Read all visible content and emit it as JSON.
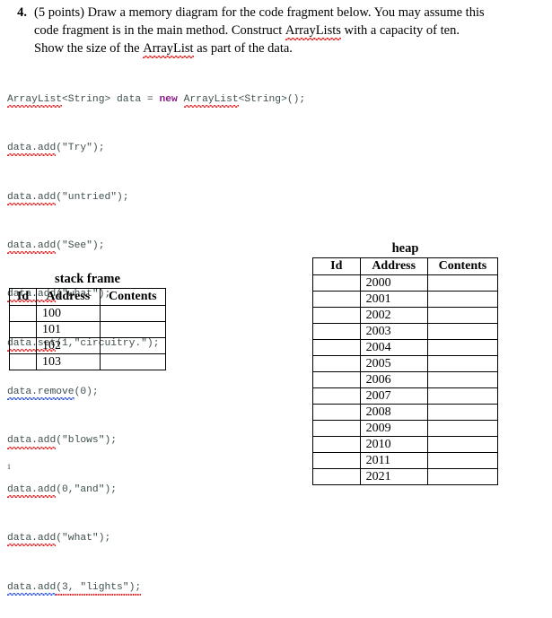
{
  "question": {
    "number": "4.",
    "points_label": "(5 points)",
    "text_part_1": "(5 points) Draw a memory diagram for the code fragment below. You may assume this code fragment is in the main method. Construct ",
    "spell_1": "ArrayLists",
    "text_part_2": " with a capacity of ten. Show the size of the ",
    "spell_2": "ArrayList",
    "text_part_3": " as part of the data.",
    "full_text": "(5 points) Draw a memory diagram for the code fragment below. You may assume this code fragment is in the main method. Construct ArrayLists with a capacity of ten. Show the size of the ArrayList as part of the data."
  },
  "code": {
    "language": "java",
    "keyword_color": "#8b1a8b",
    "identifier_color": "#3f4f4f",
    "lines": [
      "ArrayList<String> data = new ArrayList<String>();",
      "data.add(\"Try\");",
      "data.add(\"untried\");",
      "data.add(\"See\");",
      "data.add(\"what\");",
      "data.set(1,\"circuitry.\");",
      "data.remove(0);",
      "data.add(\"blows\");",
      "data.add(0,\"and\");",
      "data.add(\"what\");",
      "data.add(3, \"lights\");"
    ],
    "tokens": {
      "line0": {
        "t1": "ArrayList",
        "t2": "<String> data = ",
        "kw": "new",
        "t3": " ",
        "t4": "ArrayList",
        "t5": "<String>();"
      },
      "line1": {
        "id": "data.add",
        "rest": "(\"Try\");"
      },
      "line2": {
        "id": "data.add",
        "rest": "(\"untried\");"
      },
      "line3": {
        "id": "data.add",
        "rest": "(\"See\");"
      },
      "line4": {
        "id": "data.add",
        "rest": "(\"what\");"
      },
      "line5": {
        "id": "data.set",
        "rest": "(1,\"circuitry.\");"
      },
      "line6": {
        "id": "data.remove",
        "rest": "(0);"
      },
      "line7": {
        "id": "data.add",
        "rest": "(\"blows\");"
      },
      "line8": {
        "id": "data.add",
        "rest": "(0,\"and\");"
      },
      "line9": {
        "id": "data.add",
        "rest": "(\"what\");"
      },
      "line10": {
        "id": "data.add",
        "rest": "(3, \"lights\");"
      }
    }
  },
  "stack_frame": {
    "title": "stack frame",
    "columns": [
      "Id",
      "Address",
      "Contents"
    ],
    "rows": [
      {
        "id": "",
        "address": "100",
        "contents": ""
      },
      {
        "id": "",
        "address": "101",
        "contents": ""
      },
      {
        "id": "",
        "address": "102",
        "contents": ""
      },
      {
        "id": "",
        "address": "103",
        "contents": ""
      }
    ]
  },
  "heap": {
    "title": "heap",
    "columns": [
      "Id",
      "Address",
      "Contents"
    ],
    "rows": [
      {
        "id": "",
        "address": "2000",
        "contents": ""
      },
      {
        "id": "",
        "address": "2001",
        "contents": ""
      },
      {
        "id": "",
        "address": "2002",
        "contents": ""
      },
      {
        "id": "",
        "address": "2003",
        "contents": ""
      },
      {
        "id": "",
        "address": "2004",
        "contents": ""
      },
      {
        "id": "",
        "address": "2005",
        "contents": ""
      },
      {
        "id": "",
        "address": "2006",
        "contents": ""
      },
      {
        "id": "",
        "address": "2007",
        "contents": ""
      },
      {
        "id": "",
        "address": "2008",
        "contents": ""
      },
      {
        "id": "",
        "address": "2009",
        "contents": ""
      },
      {
        "id": "",
        "address": "2010",
        "contents": ""
      },
      {
        "id": "",
        "address": "2011",
        "contents": ""
      },
      {
        "id": "",
        "address": "2021",
        "contents": ""
      }
    ]
  },
  "footer": {
    "page_number": "1"
  }
}
